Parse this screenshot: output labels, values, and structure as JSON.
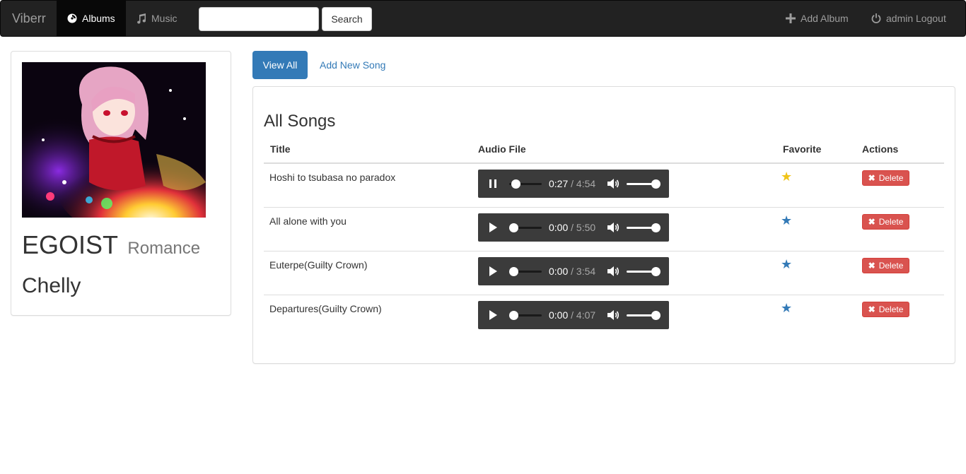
{
  "navbar": {
    "brand": "Viberr",
    "albums_label": "Albums",
    "music_label": "Music",
    "search_value": "",
    "search_button": "Search",
    "add_album_label": "Add Album",
    "logout_label": "admin Logout"
  },
  "album": {
    "title": "EGOIST",
    "genre": "Romance",
    "artist": "Chelly"
  },
  "tabs": {
    "view_all": "View All",
    "add_song": "Add New Song"
  },
  "songs_panel": {
    "heading": "All Songs",
    "columns": [
      "Title",
      "Audio File",
      "Favorite",
      "Actions"
    ]
  },
  "songs": [
    {
      "title": "Hoshi to tsubasa no paradox",
      "current_time": "0:27",
      "duration": "/ 4:54",
      "playing": true,
      "favorite": true
    },
    {
      "title": "All alone with you",
      "current_time": "0:00",
      "duration": "/ 5:50",
      "playing": false,
      "favorite": false
    },
    {
      "title": "Euterpe(Guilty Crown)",
      "current_time": "0:00",
      "duration": "/ 3:54",
      "playing": false,
      "favorite": false
    },
    {
      "title": "Departures(Guilty Crown)",
      "current_time": "0:00",
      "duration": "/ 4:07",
      "playing": false,
      "favorite": false
    }
  ],
  "delete_label": "Delete",
  "colors": {
    "navbar_bg": "#222222",
    "primary": "#337ab7",
    "danger": "#d9534f",
    "favorite_star": "#f0c419",
    "normal_star": "#337ab7"
  }
}
